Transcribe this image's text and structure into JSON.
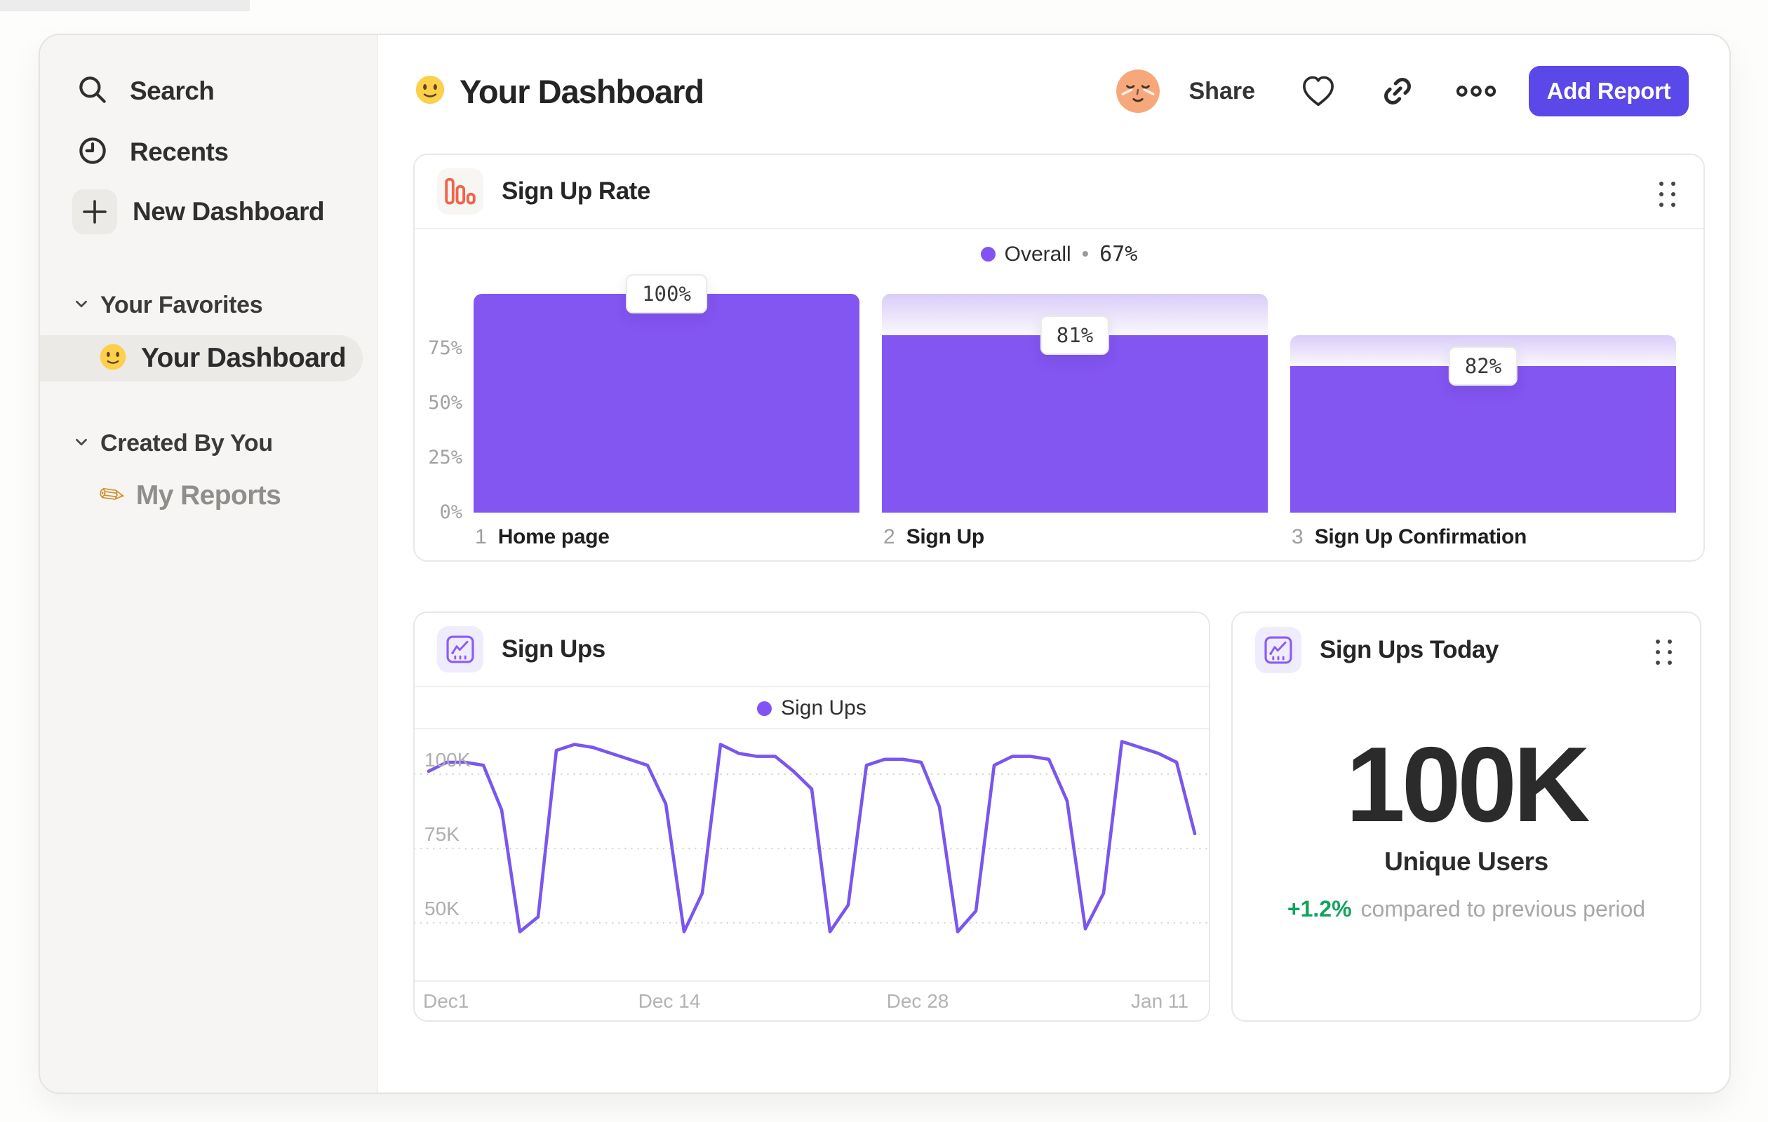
{
  "sidebar": {
    "search": "Search",
    "recents": "Recents",
    "new_dashboard": "New Dashboard",
    "favorites_header": "Your Favorites",
    "favorite_label": "Your Dashboard",
    "created_header": "Created By You",
    "report_label": "My Reports",
    "report_emoji": "✏"
  },
  "header": {
    "title": "Your Dashboard",
    "share": "Share",
    "add_report": "Add Report"
  },
  "colors": {
    "accent_purple": "#8355f1",
    "legend_dot": "#8152f4",
    "button_indigo": "#5a48e8",
    "funnel_icon_orange": "#f0654a",
    "delta_green": "#12a35b"
  },
  "icons": [
    "search-icon",
    "clock-icon",
    "plus-icon",
    "chevron-down-icon",
    "smiley-emoji-icon",
    "pencil-icon",
    "avatar-face",
    "heart-icon",
    "link-icon",
    "more-dots-icon",
    "funnel-chart-icon",
    "line-chart-icon",
    "drag-handle"
  ],
  "chart_data": [
    {
      "type": "bar",
      "title": "Sign Up Rate",
      "legend": {
        "label": "Overall",
        "sep": "•",
        "value": "67%"
      },
      "step_numbers": [
        "1",
        "2",
        "3"
      ],
      "categories": [
        "Home page",
        "Sign Up",
        "Sign Up Confirmation"
      ],
      "conversion_pct": [
        100,
        81,
        82
      ],
      "cumulative_pct": [
        100,
        81,
        67
      ],
      "value_labels": [
        "100%",
        "81%",
        "82%"
      ],
      "y_ticks": [
        "75%",
        "50%",
        "25%",
        "0%"
      ],
      "ylim": [
        0,
        100
      ],
      "bar_color": "#8355f1"
    },
    {
      "type": "line",
      "title": "Sign Ups",
      "legend": "Sign Ups",
      "x_ticks": [
        "Dec1",
        "Dec 14",
        "Dec 28",
        "Jan 11"
      ],
      "y_ticks": [
        "100K",
        "75K",
        "50K"
      ],
      "y_tick_values": [
        100,
        75,
        50
      ],
      "unit": "K",
      "ylim": [
        40,
        115
      ],
      "grid": "dotted",
      "line_color": "#7a56ee",
      "values": [
        101,
        104,
        104,
        103,
        88,
        47,
        52,
        108,
        110,
        109,
        107,
        105,
        103,
        90,
        47,
        60,
        110,
        107,
        106,
        106,
        101,
        95,
        47,
        56,
        103,
        105,
        105,
        104,
        89,
        47,
        54,
        103,
        106,
        106,
        105,
        91,
        48,
        60,
        111,
        109,
        107,
        104,
        80
      ]
    },
    {
      "type": "metric",
      "title": "Sign Ups Today",
      "value": "100K",
      "label": "Unique Users",
      "delta": "+1.2%",
      "delta_context": "compared to previous period"
    }
  ]
}
